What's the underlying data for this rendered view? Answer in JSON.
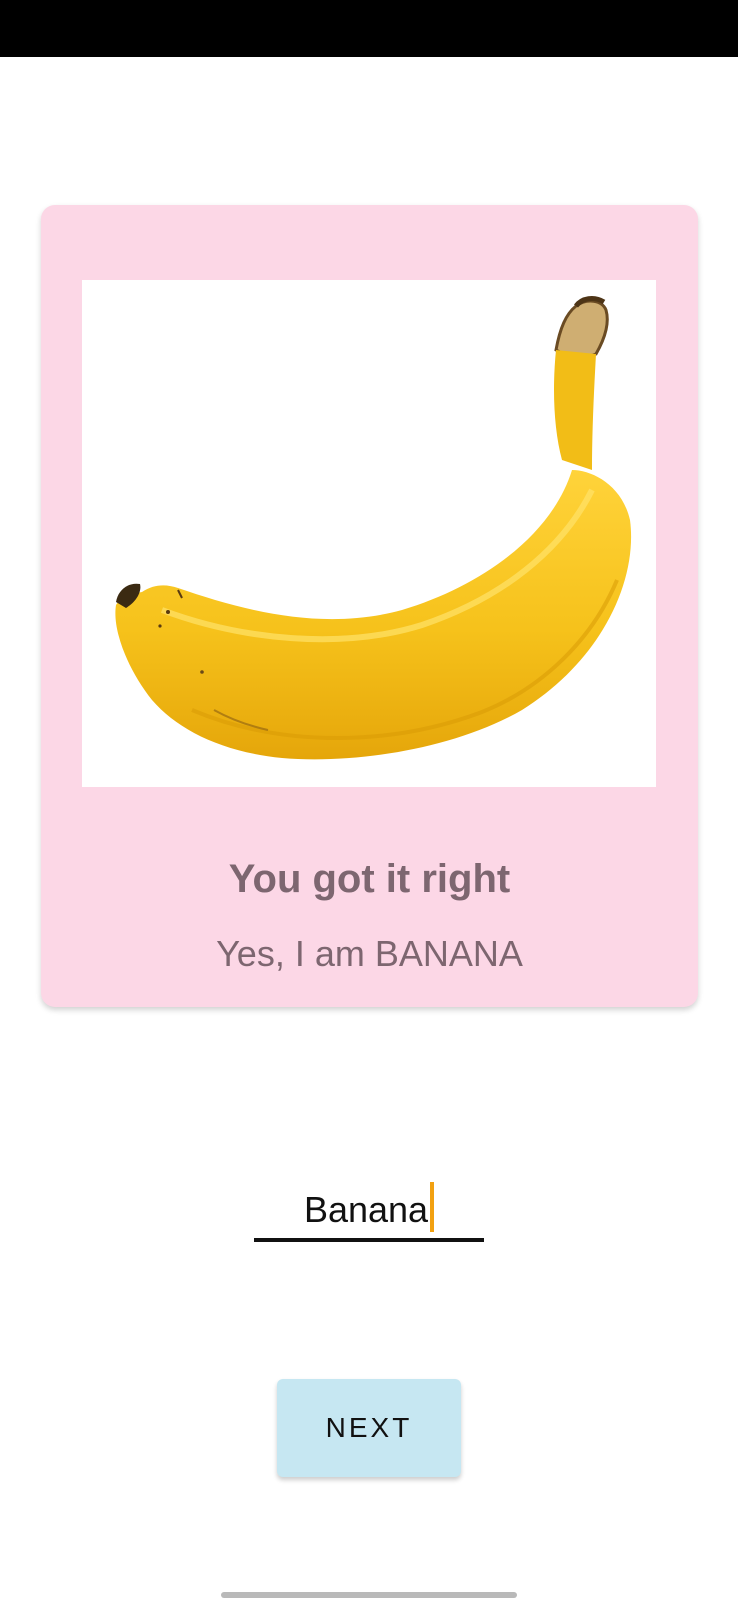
{
  "result": {
    "title": "You got it right",
    "subtitle": "Yes, I am BANANA"
  },
  "image": {
    "subject": "banana-image"
  },
  "answer_input": {
    "value": "Banana"
  },
  "actions": {
    "next_label": "NEXT"
  },
  "colors": {
    "card_background": "#fcd7e6",
    "button_background": "#c6e7f2",
    "text_secondary": "#7d6670",
    "caret": "#f2a111"
  }
}
